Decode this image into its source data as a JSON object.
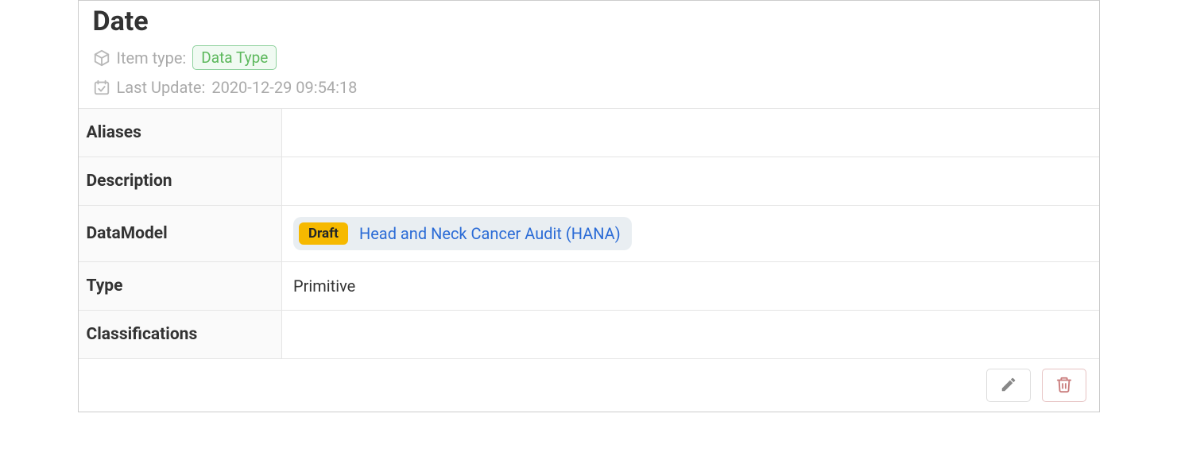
{
  "header": {
    "title": "Date",
    "item_type_label": "Item type:",
    "item_type_badge": "Data Type",
    "last_update_label": "Last Update:",
    "last_update_value": "2020-12-29 09:54:18"
  },
  "details": {
    "aliases": {
      "label": "Aliases",
      "value": ""
    },
    "description": {
      "label": "Description",
      "value": ""
    },
    "datamodel": {
      "label": "DataModel",
      "status_badge": "Draft",
      "link_text": "Head and Neck Cancer Audit (HANA)"
    },
    "type": {
      "label": "Type",
      "value": "Primitive"
    },
    "classifications": {
      "label": "Classifications",
      "value": ""
    }
  }
}
